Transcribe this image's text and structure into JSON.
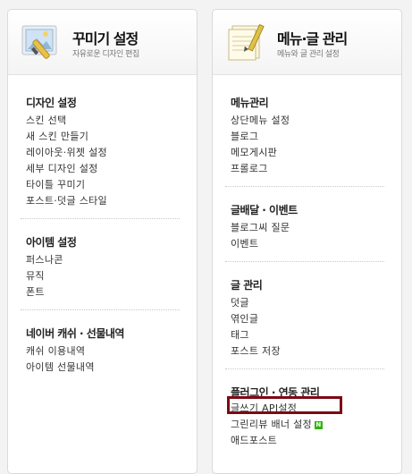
{
  "left_panel": {
    "title": "꾸미기 설정",
    "subtitle": "자유로운 디자인 편집",
    "sections": [
      {
        "title": "디자인 설정",
        "items": [
          "스킨 선택",
          "새 스킨 만들기",
          "레이아웃·위젯 설정",
          "세부 디자인 설정",
          "타이틀 꾸미기",
          "포스트·덧글 스타일"
        ]
      },
      {
        "title": "아이템 설정",
        "items": [
          "퍼스나콘",
          "뮤직",
          "폰트"
        ]
      },
      {
        "title": "네이버 캐쉬 · 선물내역",
        "items": [
          "캐쉬 이용내역",
          "아이템 선물내역"
        ]
      }
    ]
  },
  "right_panel": {
    "title": "메뉴·글 관리",
    "subtitle": "메뉴와 글 관리 설정",
    "sections": [
      {
        "title": "메뉴관리",
        "items": [
          "상단메뉴 설정",
          "블로그",
          "메모게시판",
          "프롤로그"
        ]
      },
      {
        "title": "글배달 · 이벤트",
        "items": [
          "블로그씨 질문",
          "이벤트"
        ]
      },
      {
        "title": "글 관리",
        "items": [
          "덧글",
          "엮인글",
          "태그",
          "포스트 저장"
        ]
      },
      {
        "title": "플러그인 · 연동 관리",
        "items": [
          "글쓰기 API설정",
          "그린리뷰 배너 설정",
          "애드포스트"
        ],
        "new_badge": "N"
      }
    ]
  },
  "colors": {
    "highlight": "#7b0a14",
    "new_badge": "#2db400"
  },
  "icons": {
    "left": "design-palette-icon",
    "right": "notepad-pencil-icon"
  }
}
